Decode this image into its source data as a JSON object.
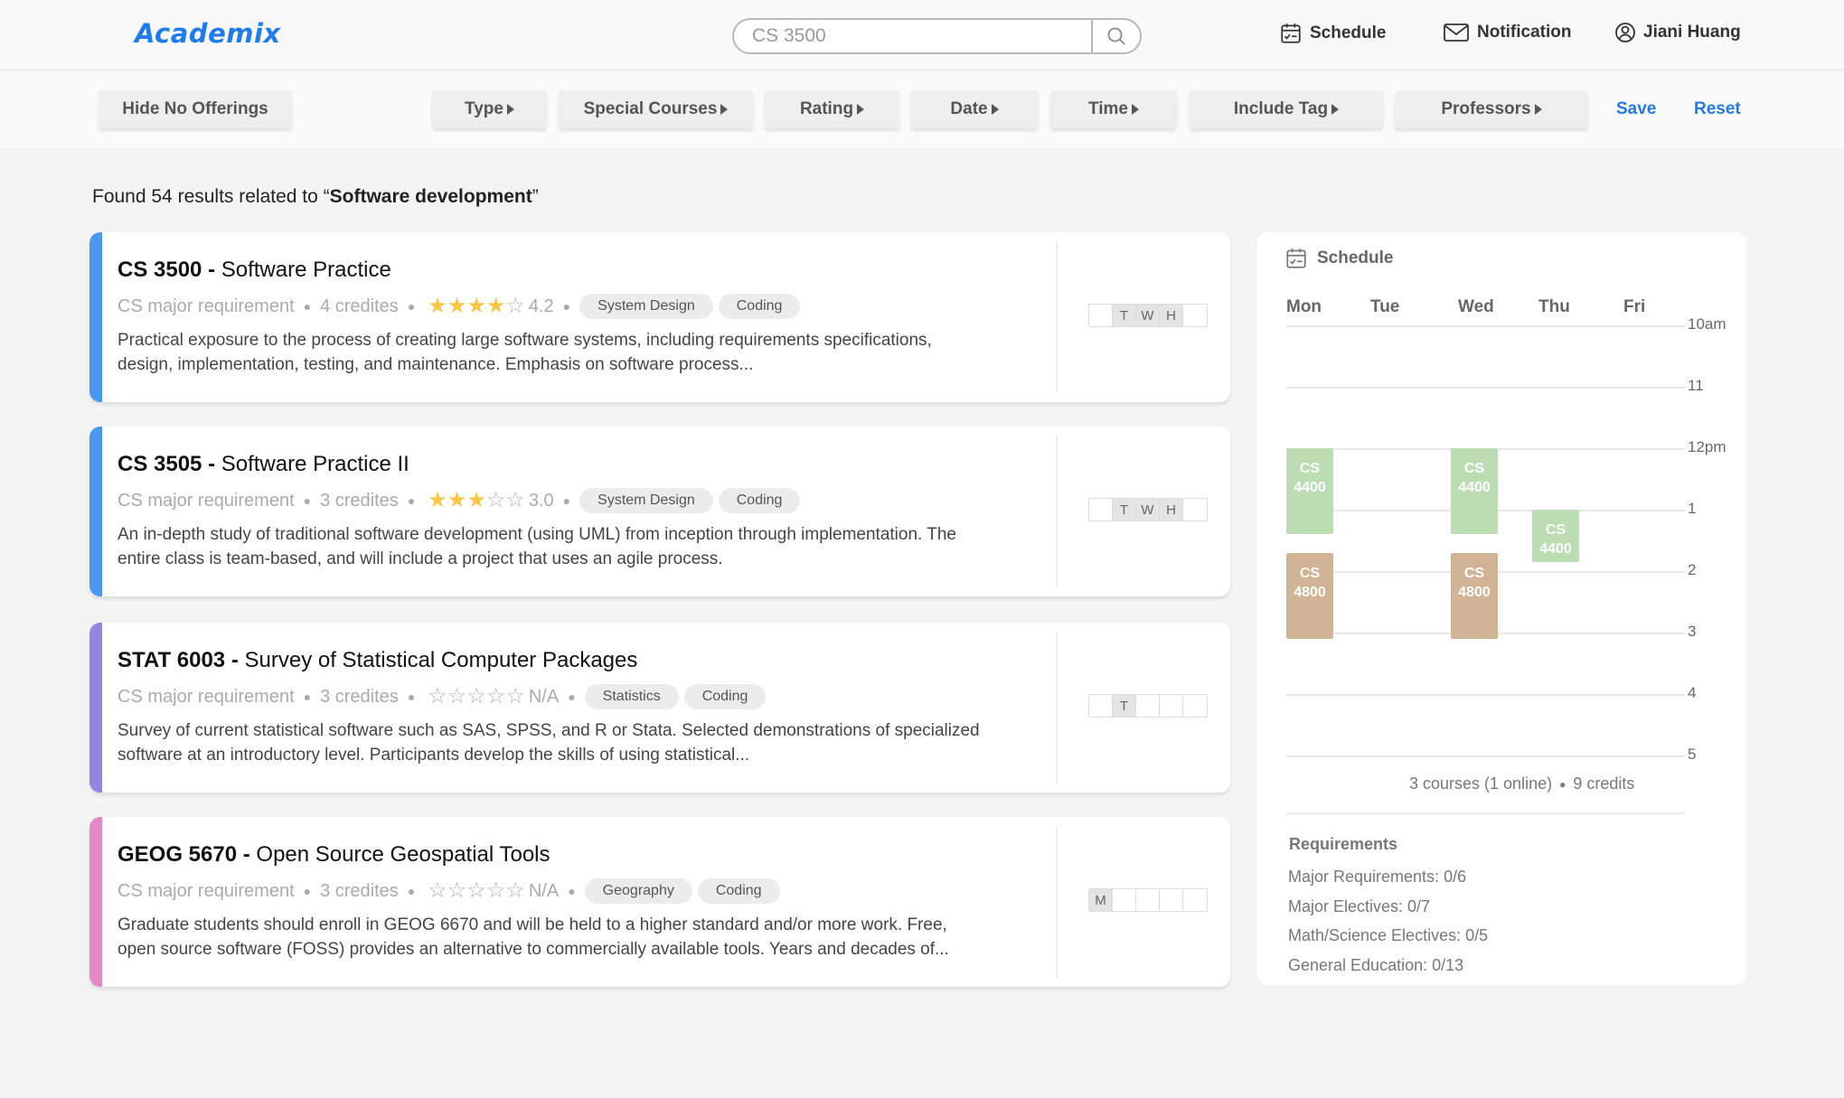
{
  "app": {
    "logo": "Academix"
  },
  "header": {
    "search_value": "CS 3500",
    "search_icon": "search-icon",
    "nav": [
      {
        "label": "Schedule",
        "icon": "calendar-check-icon"
      },
      {
        "label": "Notification",
        "icon": "mail-icon"
      },
      {
        "label": "Jiani Huang",
        "icon": "user-circle-icon"
      }
    ]
  },
  "filters": {
    "hide_no_offerings": "Hide No Offerings",
    "dropdowns": [
      "Type",
      "Special Courses",
      "Rating",
      "Date",
      "Time",
      "Include Tag",
      "Professors"
    ],
    "save": "Save",
    "reset": "Reset"
  },
  "results": {
    "prefix": "Found 54 results related to “",
    "query": "Software development",
    "suffix": "”"
  },
  "courses": [
    {
      "code": "CS 3500 -",
      "name": "Software Practice",
      "requirement": "CS major requirement",
      "credits": "4 credites",
      "rating_stars": 4,
      "rating_text": "4.2",
      "tags": [
        "System Design",
        "Coding"
      ],
      "description": "Practical exposure to the process of creating large software systems, including requirements specifications, design, implementation, testing, and maintenance. Emphasis on software process...",
      "accent": "#4a97f0",
      "days": [
        "",
        "T",
        "W",
        "H",
        ""
      ],
      "days_on": [
        false,
        true,
        true,
        true,
        false
      ]
    },
    {
      "code": "CS 3505 -",
      "name": "Software Practice II",
      "requirement": "CS major requirement",
      "credits": "3 credites",
      "rating_stars": 3,
      "rating_text": "3.0",
      "tags": [
        "System Design",
        "Coding"
      ],
      "description": "An in-depth study of traditional software development (using UML) from inception through implementation. The entire class is team-based, and will include a project that uses an agile process.",
      "accent": "#4a97f0",
      "days": [
        "",
        "T",
        "W",
        "H",
        ""
      ],
      "days_on": [
        false,
        true,
        true,
        true,
        false
      ]
    },
    {
      "code": "STAT 6003 -",
      "name": "Survey of Statistical Computer Packages",
      "requirement": "CS major requirement",
      "credits": "3 credites",
      "rating_stars": 0,
      "rating_text": "N/A",
      "tags": [
        "Statistics",
        "Coding"
      ],
      "description": "Survey of current statistical software such as SAS, SPSS, and R or Stata. Selected demonstrations of specialized software at an introductory level. Participants develop the skills of using statistical...",
      "accent": "#9187e0",
      "days": [
        "",
        "T",
        "",
        "",
        ""
      ],
      "days_on": [
        false,
        true,
        false,
        false,
        false
      ]
    },
    {
      "code": "GEOG 5670 -",
      "name": "Open Source Geospatial Tools",
      "requirement": "CS major requirement",
      "credits": "3 credites",
      "rating_stars": 0,
      "rating_text": "N/A",
      "tags": [
        "Geography",
        "Coding"
      ],
      "description": "Graduate students should enroll in GEOG 6670 and will be held to a higher standard and/or more work. Free, open source software (FOSS) provides an alternative to commercially available tools. Years and decades of...",
      "accent": "#e38ac6",
      "days": [
        "M",
        "",
        "",
        "",
        ""
      ],
      "days_on": [
        true,
        false,
        false,
        false,
        false
      ]
    }
  ],
  "schedule": {
    "title": "Schedule",
    "days": [
      "Mon",
      "Tue",
      "Wed",
      "Thu",
      "Fri"
    ],
    "hours": [
      "10am",
      "11",
      "12pm",
      "1",
      "2",
      "3",
      "4",
      "5"
    ],
    "blocks": [
      {
        "line1": "CS",
        "line2": "4400",
        "day": 0,
        "start": 12.0,
        "end": 13.4,
        "color": "#bcdcb4"
      },
      {
        "line1": "CS",
        "line2": "4400",
        "day": 2,
        "start": 12.0,
        "end": 13.4,
        "color": "#bcdcb4"
      },
      {
        "line1": "CS",
        "line2": "4400",
        "day": 3,
        "start": 13.0,
        "end": 13.85,
        "color": "#bcdcb4"
      },
      {
        "line1": "CS",
        "line2": "4800",
        "day": 0,
        "start": 13.7,
        "end": 15.1,
        "color": "#d1b396"
      },
      {
        "line1": "CS",
        "line2": "4800",
        "day": 2,
        "start": 13.7,
        "end": 15.1,
        "color": "#d1b396"
      }
    ],
    "summary_courses": "3 courses (1 online)",
    "summary_credits": "9 credits",
    "requirements_title": "Requirements",
    "requirements": [
      "Major Requirements: 0/6",
      "Major Electives: 0/7",
      "Math/Science Electives: 0/5",
      "General Education: 0/13"
    ]
  }
}
